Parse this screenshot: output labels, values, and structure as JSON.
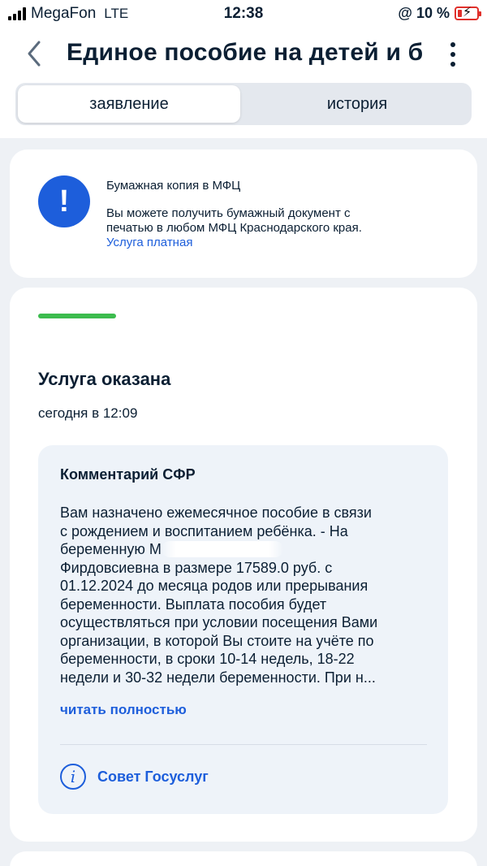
{
  "status_bar": {
    "carrier": "MegaFon",
    "network": "LTE",
    "time": "12:38",
    "battery": "@ 10 %"
  },
  "header": {
    "title": "Единое пособие на детей и б...",
    "back_icon": "chevron-left-icon",
    "menu_icon": "kebab-menu-icon"
  },
  "tabs": [
    {
      "label": "заявление",
      "active": true
    },
    {
      "label": "история",
      "active": false
    }
  ],
  "info_card": {
    "icon": "exclamation-icon",
    "title": "Бумажная копия в МФЦ",
    "body_lines": [
      "Вы можете получить бумажный документ с",
      "печатью в любом МФЦ Краснодарского края."
    ],
    "link": "Услуга платная"
  },
  "status": {
    "title": "Услуга оказана",
    "time": "сегодня в 12:09",
    "progress_color": "#3cbc4e"
  },
  "comment": {
    "title": "Комментарий СФР",
    "lines": [
      "Вам назначено ежемесячное пособие в связи",
      "с рождением и воспитанием ребёнка. - На",
      "беременную М",
      "Фирдовсиевна в размере 17589.0 руб. с",
      "01.12.2024 до месяца родов или прерывания",
      "беременности. Выплата пособия будет",
      "осуществляться при условии посещения Вами",
      "организации, в которой Вы стоите на учёте по",
      "беременности, в сроки 10-14 недель, 18-22",
      "недели и 30-32 недели беременности. При н..."
    ],
    "read_more": "читать полностью",
    "tip_label": "Совет Госуслуг",
    "tip_icon": "info-icon"
  },
  "colors": {
    "accent": "#1d5edb",
    "background": "#eef1f5",
    "text": "#0b1f33"
  }
}
